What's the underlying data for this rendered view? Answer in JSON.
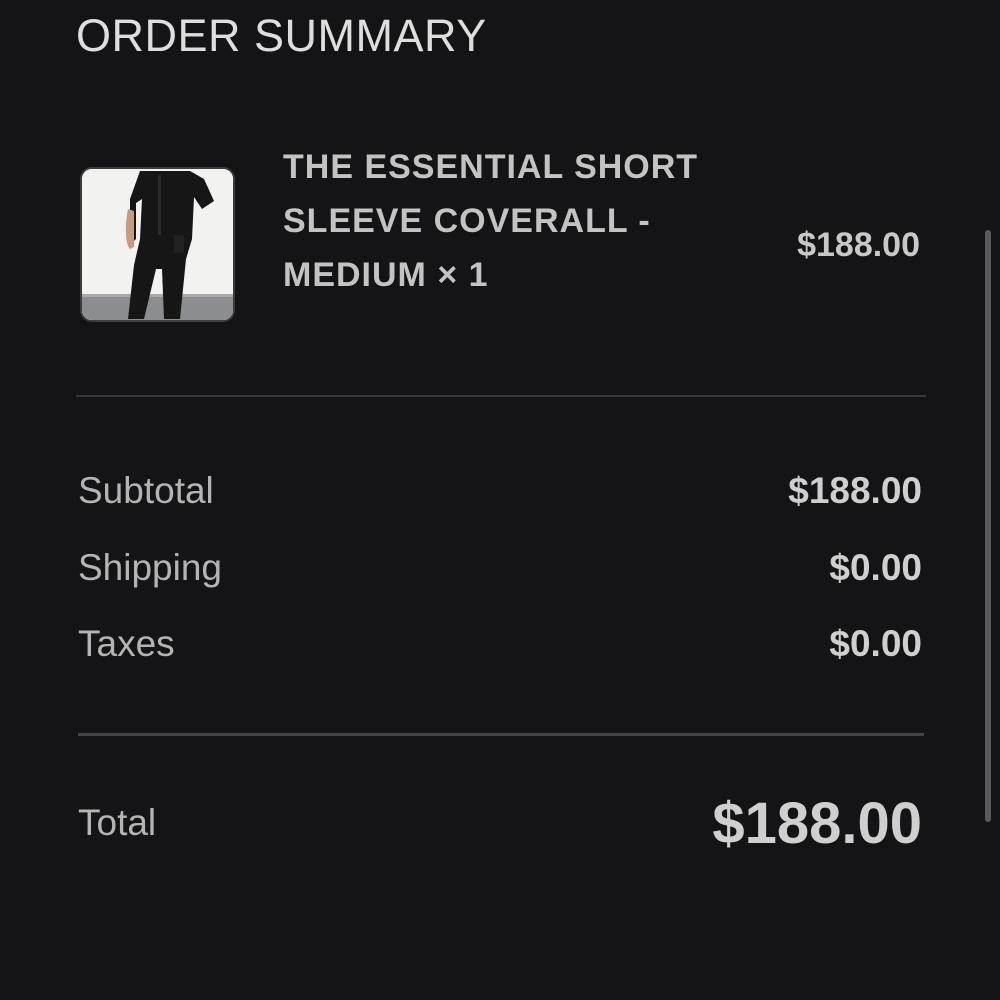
{
  "header": {
    "title": "ORDER SUMMARY"
  },
  "line_item": {
    "image": "coverall-product-photo",
    "name": "THE ESSENTIAL SHORT SLEEVE COVERALL - MEDIUM × 1",
    "price": "$188.00"
  },
  "summary": {
    "subtotal_label": "Subtotal",
    "subtotal_value": "$188.00",
    "shipping_label": "Shipping",
    "shipping_value": "$0.00",
    "taxes_label": "Taxes",
    "taxes_value": "$0.00"
  },
  "total": {
    "label": "Total",
    "value": "$188.00"
  },
  "colors": {
    "background": "#141416",
    "text": "#c8c8c8",
    "divider": "#3a3a3d"
  }
}
